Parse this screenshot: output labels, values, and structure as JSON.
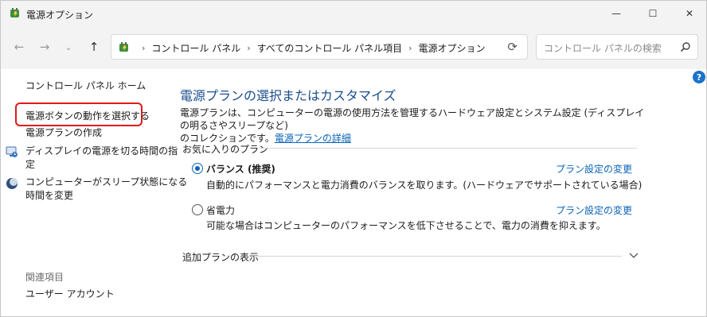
{
  "window": {
    "title": "電源オプション",
    "minimize_glyph": "—",
    "maximize_glyph": "☐",
    "close_glyph": "✕"
  },
  "nav": {
    "back_glyph": "←",
    "forward_glyph": "→",
    "recent_glyph": "⌄",
    "up_glyph": "↑",
    "breadcrumb": [
      "コントロール パネル",
      "すべてのコントロール パネル項目",
      "電源オプション"
    ],
    "separator": "›",
    "refresh_glyph": "⟳",
    "search_placeholder": "コントロール パネルの検索"
  },
  "sidebar": {
    "home": "コントロール パネル ホーム",
    "power_button": "電源ボタンの動作を選択する",
    "create_plan": "電源プランの作成",
    "display_off_line1": "ディスプレイの電源を切る時間の指",
    "display_off_line2": "定",
    "sleep_line1": "コンピューターがスリープ状態になる",
    "sleep_line2": "時間を変更",
    "related_heading": "関連項目",
    "user_accounts": "ユーザー アカウント"
  },
  "help": {
    "glyph": "?"
  },
  "main": {
    "title": "電源プランの選択またはカスタマイズ",
    "description_line1": "電源プランは、コンピューターの電源の使用方法を管理するハードウェア設定とシステム設定 (ディスプレイの明るさやスリープなど)",
    "description_line2_prefix": "のコレクションです。",
    "description_link": "電源プランの詳細",
    "favorites_heading": "お気に入りのプラン",
    "plans": [
      {
        "name": "バランス (推奨)",
        "selected": true,
        "description": "自動的にパフォーマンスと電力消費のバランスを取ります。(ハードウェアでサポートされている場合)",
        "link": "プラン設定の変更"
      },
      {
        "name": "省電力",
        "selected": false,
        "description": "可能な場合はコンピューターのパフォーマンスを低下させることで、電力の消費を抑えます。",
        "link": "プラン設定の変更"
      }
    ],
    "more_plans": "追加プランの表示"
  },
  "colors": {
    "accent": "#0a63b8",
    "highlight_box": "#e01a1a",
    "title_blue": "#1a4d8c"
  }
}
